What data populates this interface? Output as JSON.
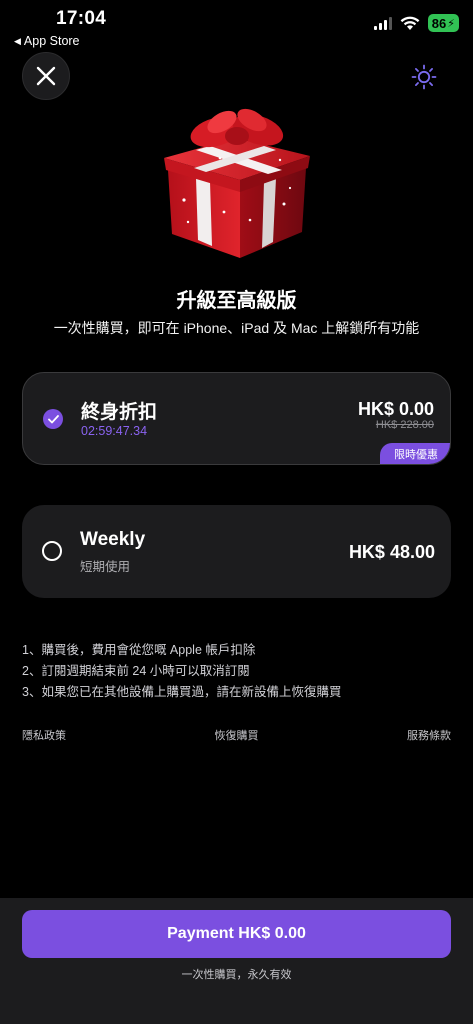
{
  "status_bar": {
    "time": "17:04",
    "back_app": "App Store",
    "battery": "86"
  },
  "header": {
    "title": "升級至高級版",
    "subtitle": "一次性購買，即可在 iPhone、iPad 及 Mac 上解鎖所有功能"
  },
  "plans": [
    {
      "name": "終身折扣",
      "sub": "02:59:47.34",
      "price": "HK$ 0.00",
      "old_price": "HK$ 228.00",
      "badge": "限時優惠",
      "selected": true
    },
    {
      "name": "Weekly",
      "sub": "短期使用",
      "price": "HK$ 48.00",
      "selected": false
    }
  ],
  "notes": [
    "1、購買後，費用會從您嘅 Apple 帳戶扣除",
    "2、訂閱週期結束前 24 小時可以取消訂閱",
    "3、如果您已在其他設備上購買過，請在新設備上恢復購買"
  ],
  "links": {
    "privacy": "隱私政策",
    "restore": "恢復購買",
    "terms": "服務條款"
  },
  "footer": {
    "pay_label": "Payment HK$ 0.00",
    "note": "一次性購買，永久有效"
  },
  "colors": {
    "accent": "#7b4fe0",
    "card_bg": "#1c1c1e",
    "battery_green": "#31c254"
  },
  "icons": {
    "close": "close-icon",
    "theme": "sun-icon",
    "gift": "gift-icon"
  }
}
